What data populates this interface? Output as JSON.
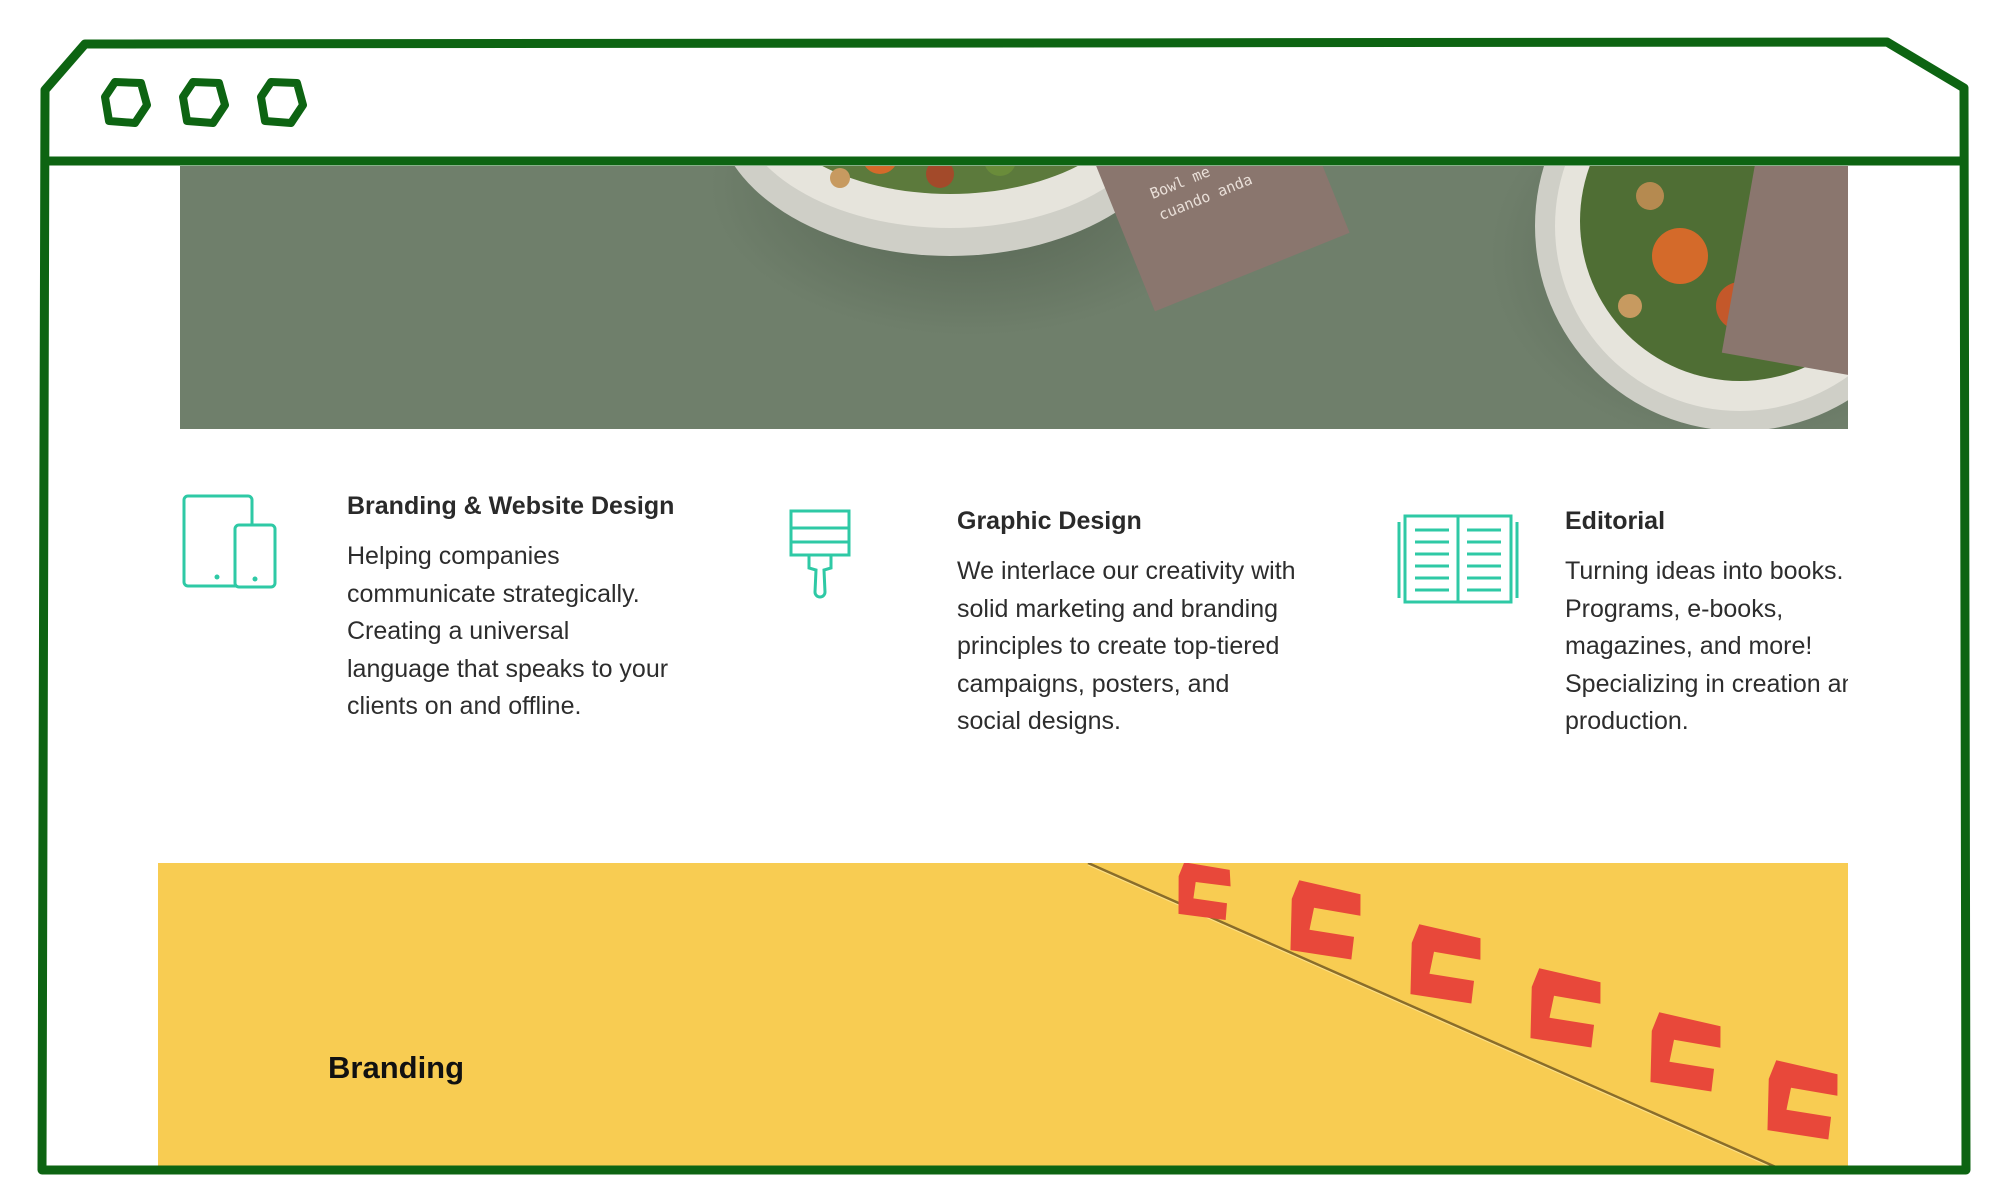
{
  "window": {
    "controls": [
      {
        "name": "window-dot-1-icon"
      },
      {
        "name": "window-dot-2-icon"
      },
      {
        "name": "window-dot-3-icon"
      }
    ],
    "frame_color": "#0d6412"
  },
  "hero": {
    "background": "#6f7f6b",
    "card_text_1": "Bowl me",
    "card_text_2": "cuando anda"
  },
  "services": [
    {
      "icon": "devices-icon",
      "title": "Branding & Website Design",
      "body": "Helping companies communicate strategically. Creating a universal language that speaks to your clients on and offline."
    },
    {
      "icon": "paint-brush-icon",
      "title": "Graphic Design",
      "body": "We interlace our creativity with solid marketing and branding principles to create top-tiered campaigns, posters, and social designs."
    },
    {
      "icon": "open-book-icon",
      "title": "Editorial",
      "body": "Turning ideas into books. Programs, e-books, magazines, and more! Specializing in creation and production."
    }
  ],
  "portfolio": {
    "label": "Branding",
    "background": "#f8cc52",
    "accent": "#e8483a"
  },
  "colors": {
    "icon_teal": "#2ec9a5"
  }
}
